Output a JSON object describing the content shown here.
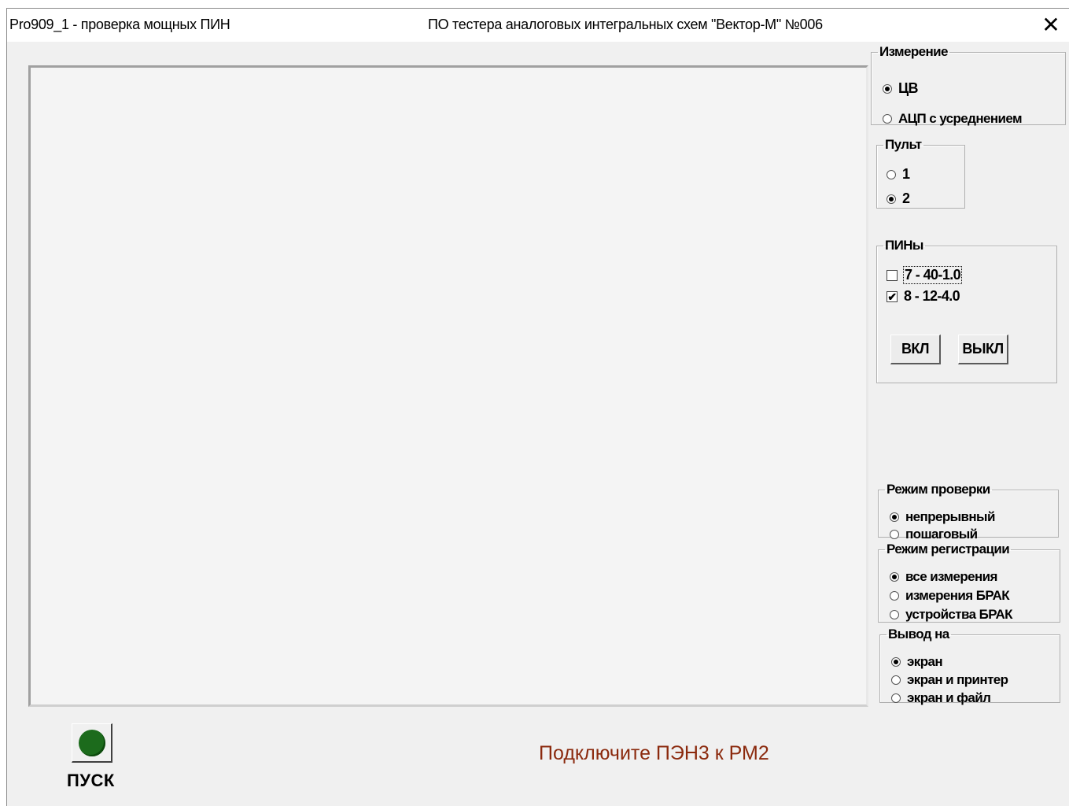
{
  "window": {
    "title_left": "Pro909_1 - проверка мощных ПИН",
    "title_center": "ПО тестера аналоговых интегральных схем \"Вектор-М\" №006",
    "close_glyph": "✕"
  },
  "measurement": {
    "legend": "Измерение",
    "options": [
      {
        "label": "ЦВ",
        "selected": true
      },
      {
        "label": "АЦП с усреднением",
        "selected": false
      }
    ]
  },
  "console": {
    "legend": "Пульт",
    "options": [
      {
        "label": "1",
        "selected": false
      },
      {
        "label": "2",
        "selected": true
      }
    ]
  },
  "pins": {
    "legend": "ПИНы",
    "items": [
      {
        "label": "7 - 40-1.0",
        "checked": false
      },
      {
        "label": "8 - 12-4.0",
        "checked": true
      }
    ],
    "on_label": "ВКЛ",
    "off_label": "ВЫКЛ"
  },
  "check_mode": {
    "legend": "Режим проверки",
    "options": [
      {
        "label": "непрерывный",
        "selected": true
      },
      {
        "label": "пошаговый",
        "selected": false
      }
    ]
  },
  "registration_mode": {
    "legend": "Режим регистрации",
    "options": [
      {
        "label": "все измерения",
        "selected": true
      },
      {
        "label": "измерения БРАК",
        "selected": false
      },
      {
        "label": "устройства БРАК",
        "selected": false
      }
    ]
  },
  "output": {
    "legend": "Вывод на",
    "options": [
      {
        "label": "экран",
        "selected": true
      },
      {
        "label": "экран и принтер",
        "selected": false
      },
      {
        "label": "экран и файл",
        "selected": false
      }
    ]
  },
  "start": {
    "label": "ПУСК",
    "led_color": "#1c6b1c"
  },
  "status": {
    "message": "Подключите ПЭН3 к РМ2",
    "color": "#8b2a0e"
  }
}
